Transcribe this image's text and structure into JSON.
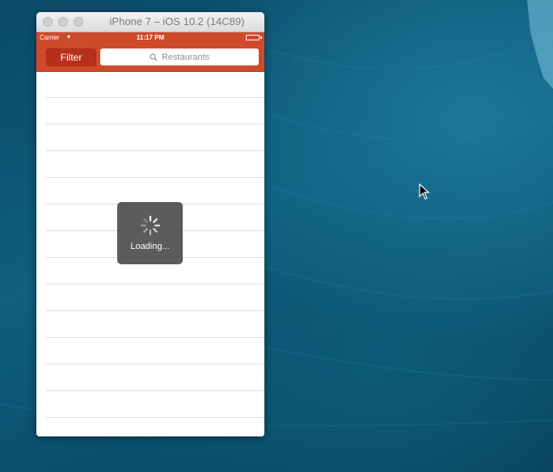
{
  "window": {
    "title": "iPhone 7 – iOS 10.2 (14C89)"
  },
  "status_bar": {
    "carrier": "Carrier",
    "time": "11:17 PM"
  },
  "nav_bar": {
    "filter_label": "Filter",
    "search_placeholder": "Restaurants",
    "accent_color": "#cf4a2b"
  },
  "loading_hud": {
    "label": "Loading..."
  },
  "list": {
    "row_count": 13
  }
}
